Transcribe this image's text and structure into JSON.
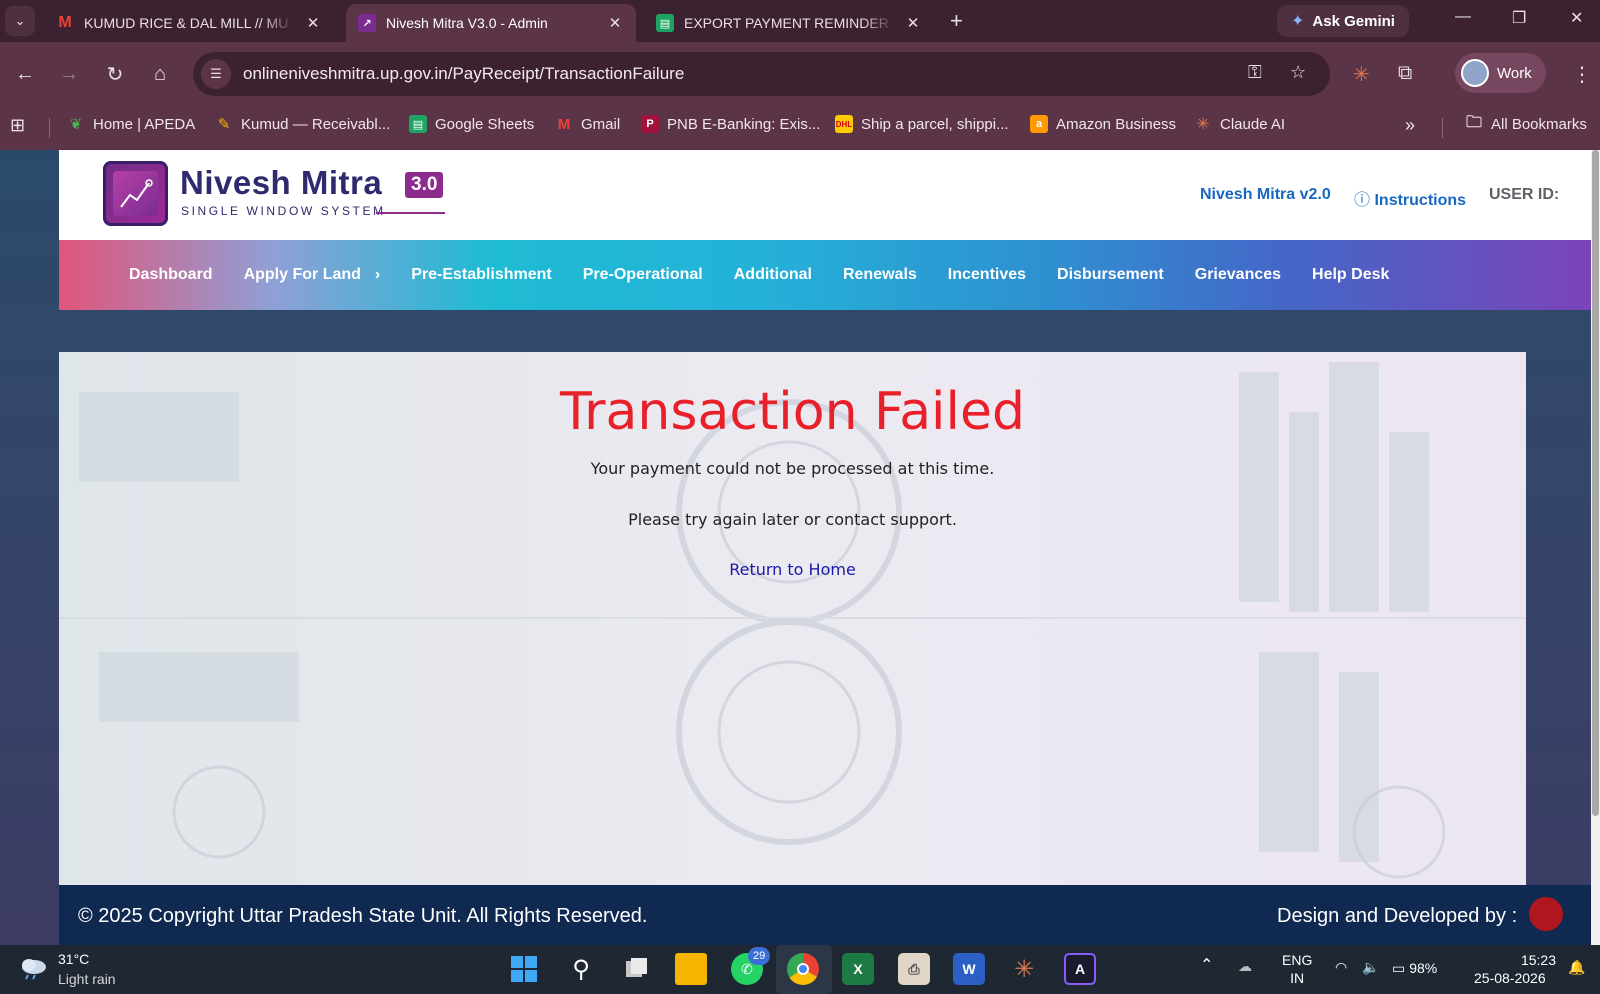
{
  "browser": {
    "tabs": [
      {
        "title": "KUMUD RICE & DAL MILL // MU",
        "icon": "gmail-icon",
        "active": false
      },
      {
        "title": "Nivesh Mitra V3.0 - Admin",
        "icon": "nivesh-mitra-icon",
        "active": true
      },
      {
        "title": "EXPORT PAYMENT REMINDER -",
        "icon": "sheets-icon",
        "active": false
      }
    ],
    "ask_gemini": "Ask Gemini",
    "url": "onlineniveshmitra.up.gov.in/PayReceipt/TransactionFailure",
    "profile_label": "Work",
    "bookmarks": [
      {
        "label": "Home | APEDA",
        "icon": "apeda-icon"
      },
      {
        "label": "Kumud — Receivabl...",
        "icon": "kumud-icon"
      },
      {
        "label": "Google Sheets",
        "icon": "sheets-icon"
      },
      {
        "label": "Gmail",
        "icon": "gmail-icon"
      },
      {
        "label": "PNB E-Banking: Exis...",
        "icon": "pnb-icon"
      },
      {
        "label": "Ship a parcel, shippi...",
        "icon": "dhl-icon"
      },
      {
        "label": "Amazon Business",
        "icon": "amazon-icon"
      },
      {
        "label": "Claude AI",
        "icon": "claude-icon"
      }
    ],
    "all_bookmarks": "All Bookmarks"
  },
  "site": {
    "logo_name": "Nivesh Mitra",
    "logo_version": "3.0",
    "logo_subtitle": "SINGLE WINDOW SYSTEM",
    "header_links": {
      "v2": "Nivesh Mitra v2.0",
      "instructions": "Instructions",
      "user_id": "USER ID:"
    },
    "menu": [
      "Dashboard",
      "Apply For Land",
      "Pre-Establishment",
      "Pre-Operational",
      "Additional",
      "Renewals",
      "Incentives",
      "Disbursement",
      "Grievances",
      "Help Desk"
    ]
  },
  "result": {
    "title": "Transaction Failed",
    "message": "Your payment could not be processed at this time.",
    "hint": "Please try again later or contact support.",
    "return_link": "Return to Home"
  },
  "footer": {
    "copyright": "© 2025 Copyright Uttar Pradesh State Unit. All Rights Reserved.",
    "developed_by": "Design and Developed by :"
  },
  "taskbar": {
    "weather_temp": "31°C",
    "weather_cond": "Light rain",
    "whatsapp_badge": "29",
    "lang_top": "ENG",
    "lang_bottom": "IN",
    "battery": "98%",
    "time": "15:23",
    "date": "25-08-2026"
  },
  "colors": {
    "failed_red": "#e8202a",
    "brand_purple": "#8e2b8f",
    "link_blue": "#1867c0",
    "footer_navy": "#0f2950"
  }
}
